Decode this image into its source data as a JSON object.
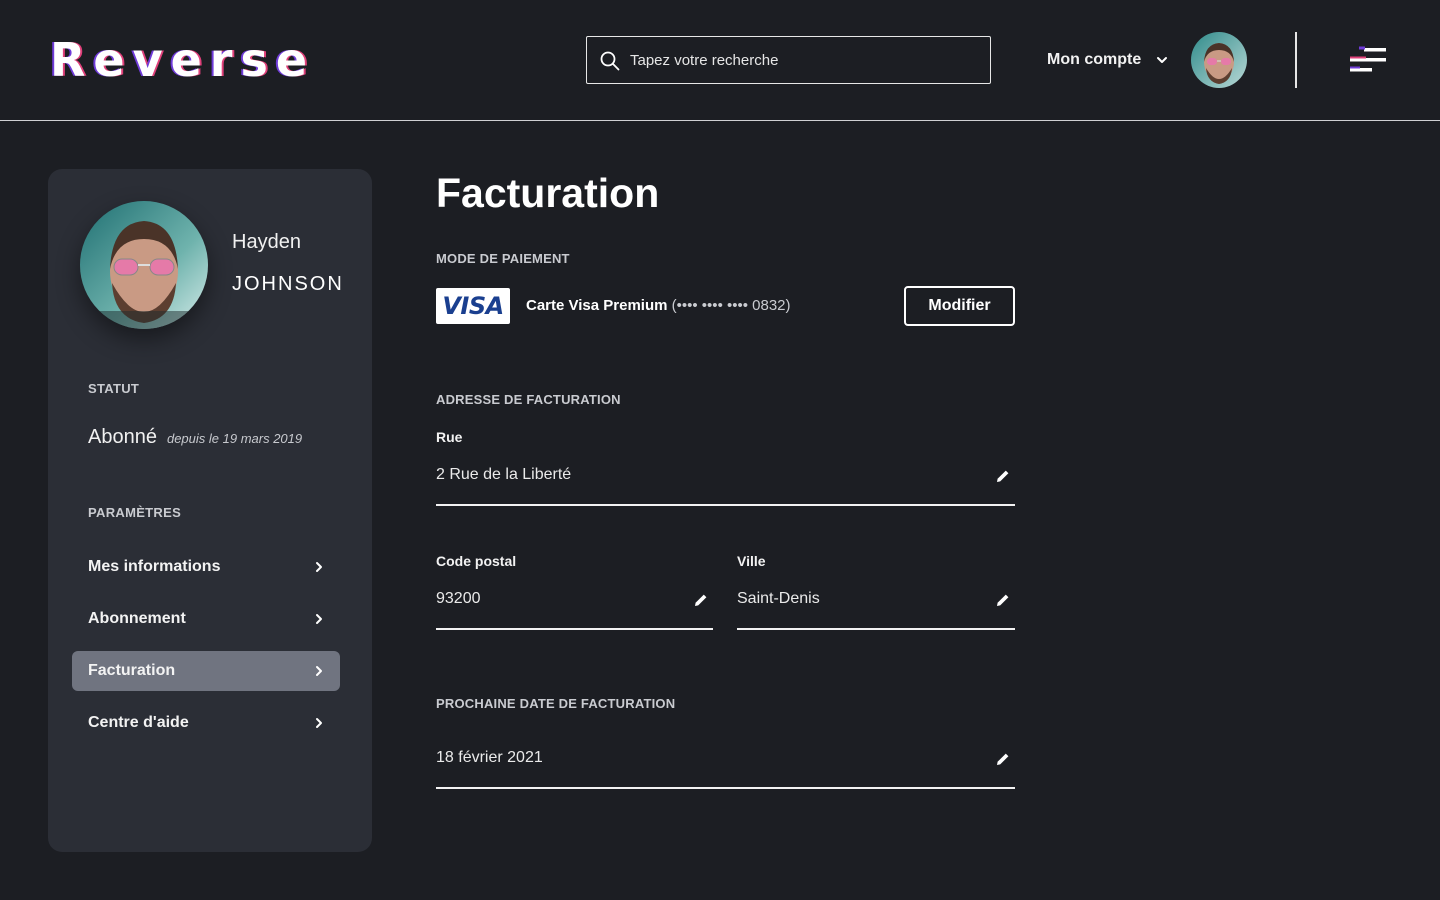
{
  "header": {
    "logo": "Reverse",
    "search": {
      "placeholder": "Tapez votre recherche"
    },
    "account_label": "Mon compte"
  },
  "sidebar": {
    "first_name": "Hayden",
    "last_name": "JOHNSON",
    "status_heading": "STATUT",
    "status_value": "Abonné",
    "status_since": "depuis le 19 mars 2019",
    "settings_heading": "PARAMÈTRES",
    "items": [
      {
        "label": "Mes informations",
        "active": false
      },
      {
        "label": "Abonnement",
        "active": false
      },
      {
        "label": "Facturation",
        "active": true
      },
      {
        "label": "Centre d'aide",
        "active": false
      }
    ]
  },
  "main": {
    "title": "Facturation",
    "payment": {
      "heading": "MODE DE PAIEMENT",
      "card_brand": "VISA",
      "card_name": "Carte Visa Premium",
      "card_number": "(•••• •••• •••• 0832)",
      "modify_label": "Modifier"
    },
    "address": {
      "heading": "ADRESSE DE FACTURATION",
      "street_label": "Rue",
      "street_value": "2 Rue de la Liberté",
      "postal_label": "Code postal",
      "postal_value": "93200",
      "city_label": "Ville",
      "city_value": "Saint-Denis"
    },
    "next_billing": {
      "heading": "PROCHAINE DATE DE FACTURATION",
      "value": "18 février 2021"
    }
  },
  "colors": {
    "background": "#1c1e23",
    "sidebar": "#2b2e36",
    "active_item": "#707480",
    "logo_accent_1": "#6f3bd8",
    "logo_accent_2": "#e0407a"
  },
  "icons": [
    "search-icon",
    "chevron-down-icon",
    "menu-icon",
    "chevron-right-icon",
    "pencil-icon"
  ]
}
